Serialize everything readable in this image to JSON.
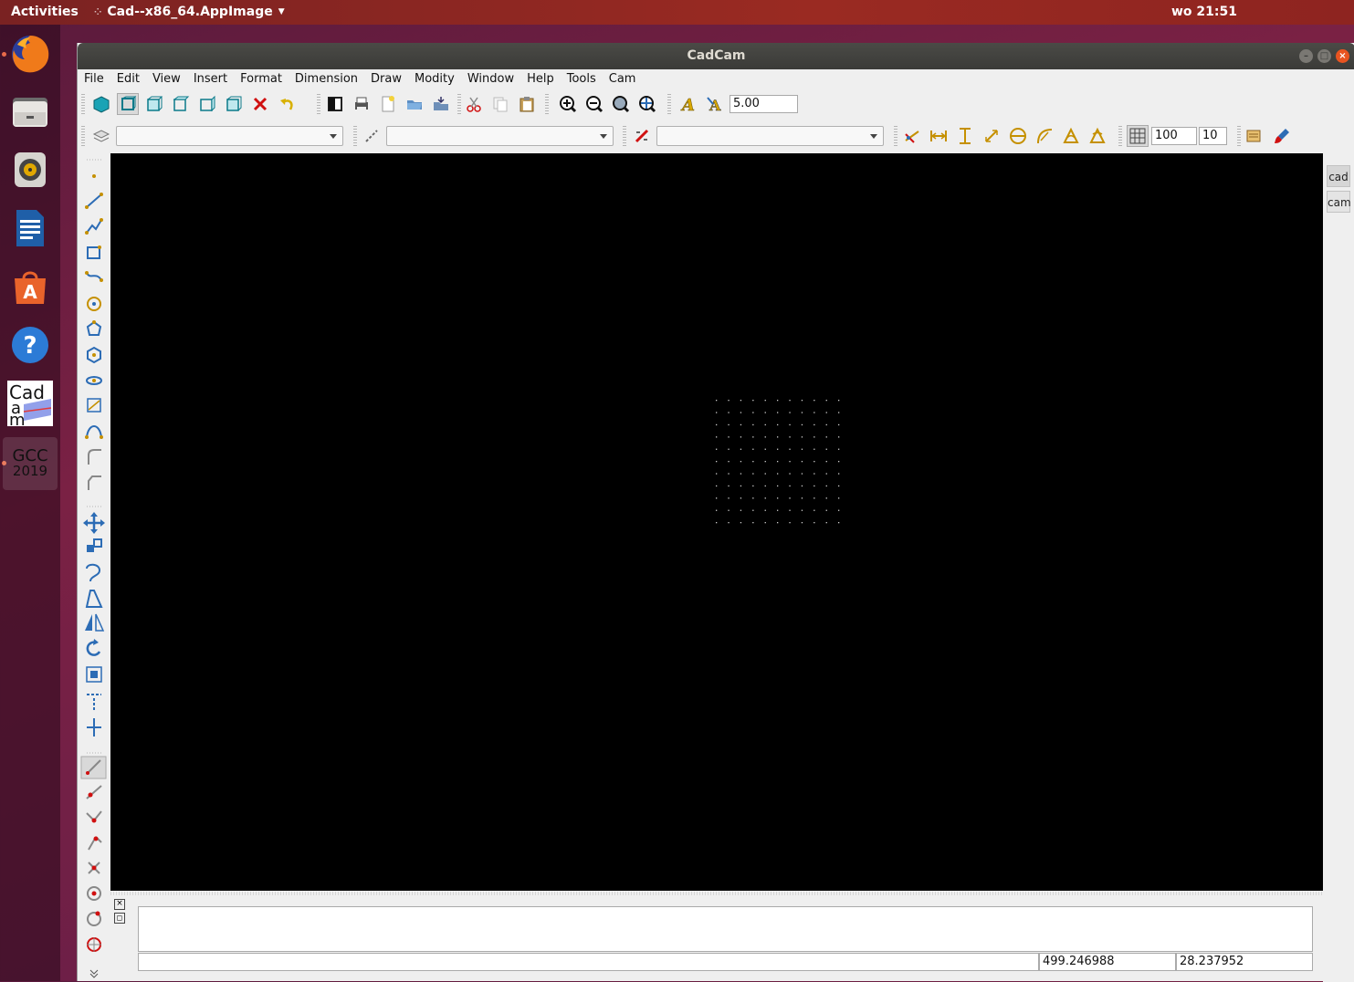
{
  "topbar": {
    "activities": "Activities",
    "app_name": "Cad--x86_64.AppImage",
    "clock": "wo 21:51"
  },
  "dock": {
    "items": [
      "firefox",
      "files",
      "rhythmbox",
      "libreoffice-writer",
      "ubuntu-software",
      "help",
      "cadcam",
      "gcc-2019"
    ],
    "cadcam_logo_text": "Cad am",
    "gcc_label_top": "GCC",
    "gcc_label_bottom": "2019"
  },
  "window": {
    "title": "CadCam",
    "menus": [
      "File",
      "Edit",
      "View",
      "Insert",
      "Format",
      "Dimension",
      "Draw",
      "Modity",
      "Window",
      "Help",
      "Tools",
      "Cam"
    ]
  },
  "toolbar1": {
    "text_height_value": "5.00"
  },
  "toolbar2": {
    "layer_combo": "",
    "linetype_combo": "",
    "linewidth_combo": "",
    "grid_spacing": "100",
    "grid_subdivision": "10"
  },
  "right_tabs": [
    "cad",
    "cam"
  ],
  "status": {
    "x_coord": "499.246988",
    "y_coord": "28.237952"
  },
  "colors": {
    "canvas": "#000000",
    "grid_dots": "#cccccc",
    "accent_teal": "#1aa3b5",
    "delete_red": "#d01010"
  }
}
